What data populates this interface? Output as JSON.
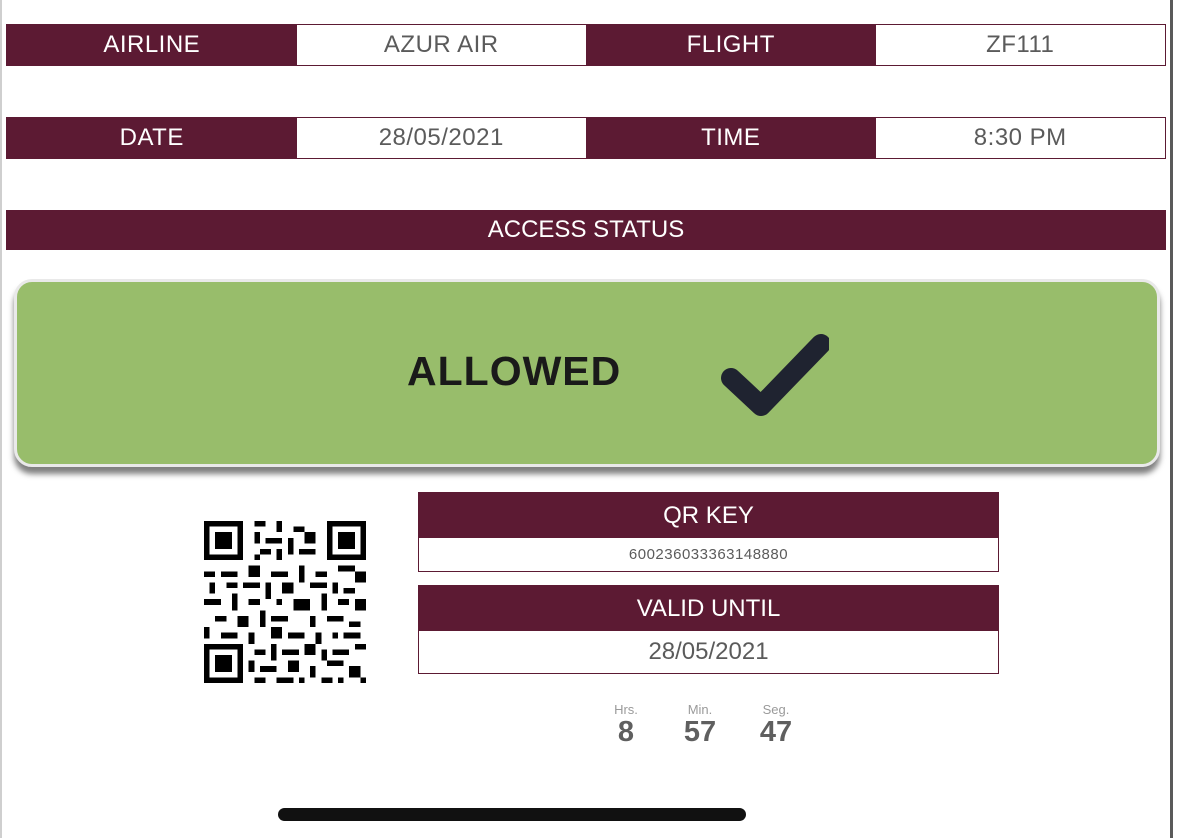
{
  "flight_info": {
    "airline_label": "AIRLINE",
    "airline_value": "AZUR AIR",
    "flight_label": "FLIGHT",
    "flight_value": "ZF111",
    "date_label": "DATE",
    "date_value": "28/05/2021",
    "time_label": "TIME",
    "time_value": "8:30 PM"
  },
  "access": {
    "header": "ACCESS STATUS",
    "status": "ALLOWED",
    "status_icon": "checkmark-icon"
  },
  "qr": {
    "icon": "qr-code",
    "key_label": "QR KEY",
    "key_value": "600236033363148880",
    "valid_label": "VALID UNTIL",
    "valid_value": "28/05/2021"
  },
  "countdown": {
    "hours_label": "Hrs.",
    "hours_value": "8",
    "minutes_label": "Min.",
    "minutes_value": "57",
    "seconds_label": "Seg.",
    "seconds_value": "47"
  },
  "colors": {
    "maroon": "#5c1a33",
    "allowed_green": "#98bd6b",
    "check_dark": "#1f2330"
  }
}
